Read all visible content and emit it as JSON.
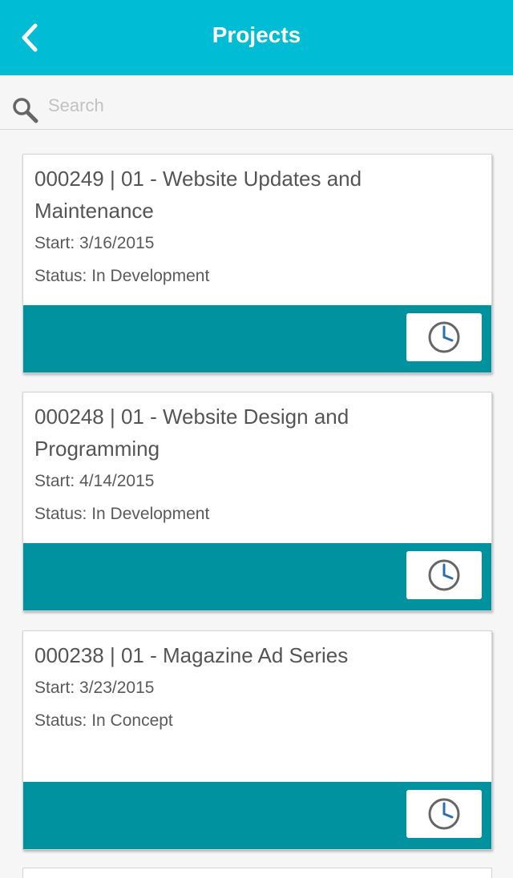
{
  "header": {
    "title": "Projects",
    "back_icon": "chevron-left-icon"
  },
  "search": {
    "placeholder": "Search",
    "value": "",
    "icon": "search-icon"
  },
  "projects": [
    {
      "title_line1": "000249 | 01 - Website Updates and",
      "title_line2": "Maintenance",
      "start": "Start: 3/16/2015",
      "status": "Status: In Development"
    },
    {
      "title_line1": "000248 | 01 - Website Design and",
      "title_line2": "Programming",
      "start": "Start: 4/14/2015",
      "status": "Status: In Development"
    },
    {
      "title_line1": "000238 | 01 - Magazine Ad Series",
      "title_line2": "",
      "start": "Start: 3/23/2015",
      "status": "Status: In Concept"
    }
  ],
  "colors": {
    "header": "#00bcd4",
    "card_footer": "#00939f",
    "clock_ring": "#666666",
    "clock_hands": "#2a6fb0"
  }
}
